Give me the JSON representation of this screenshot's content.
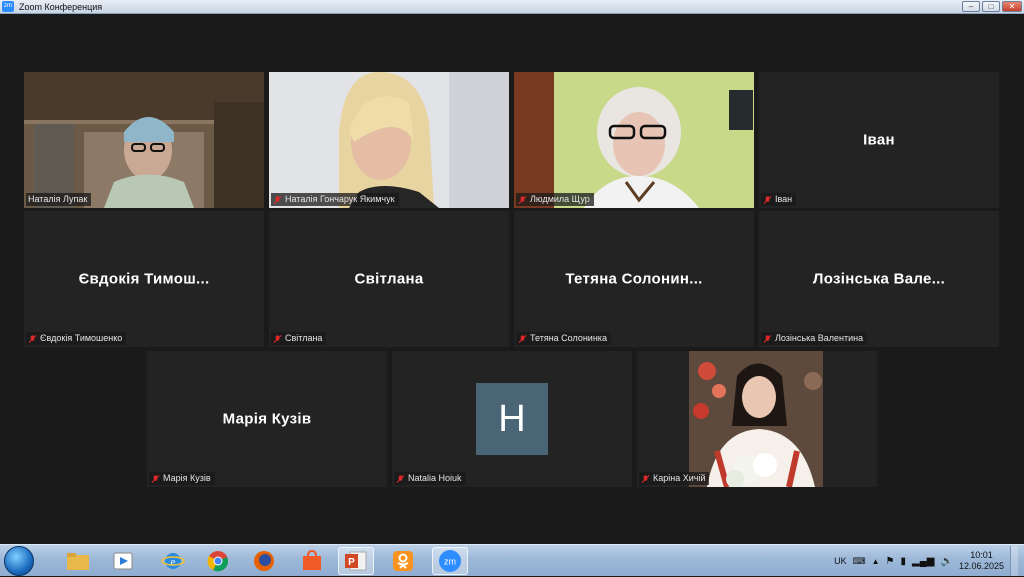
{
  "window": {
    "title": "Zoom Конференция",
    "logo_text": "zm"
  },
  "participants": [
    {
      "name": "Наталія Лупак",
      "video": true,
      "active": true,
      "muted": false
    },
    {
      "name": "Наталія Гончарук Якимчук",
      "video": true,
      "muted": true
    },
    {
      "name": "Людмила Щур",
      "video": true,
      "muted": true
    },
    {
      "name": "Іван",
      "display": "Іван",
      "video": false,
      "muted": true
    },
    {
      "name": "Євдокія Тимошенко",
      "display": "Євдокія Тимош...",
      "video": false,
      "muted": true
    },
    {
      "name": "Світлана",
      "display": "Світлана",
      "video": false,
      "muted": true
    },
    {
      "name": "Тетяна Солонинка",
      "display": "Тетяна Солонин...",
      "video": false,
      "muted": true
    },
    {
      "name": "Лозінська Валентина",
      "display": "Лозінська Вале...",
      "video": false,
      "muted": true
    },
    {
      "name": "Марія Кузів",
      "display": "Марія Кузів",
      "video": false,
      "muted": true
    },
    {
      "name": "Natalia Hoiuk",
      "avatar_letter": "H",
      "video": false,
      "muted": true
    },
    {
      "name": "Каріна Хичій",
      "video": true,
      "muted": true
    }
  ],
  "taskbar": {
    "apps": [
      "file-explorer",
      "media-player",
      "internet-explorer",
      "chrome",
      "firefox",
      "store",
      "powerpoint",
      "odnoklassniki",
      "zoom"
    ],
    "zoom_label": "zm",
    "language": "UK",
    "time": "10:01",
    "date": "12.06.2025"
  },
  "colors": {
    "active_speaker": "#c6e36b",
    "muted_mic": "#e02828",
    "avatar_bg": "#4a6576"
  }
}
